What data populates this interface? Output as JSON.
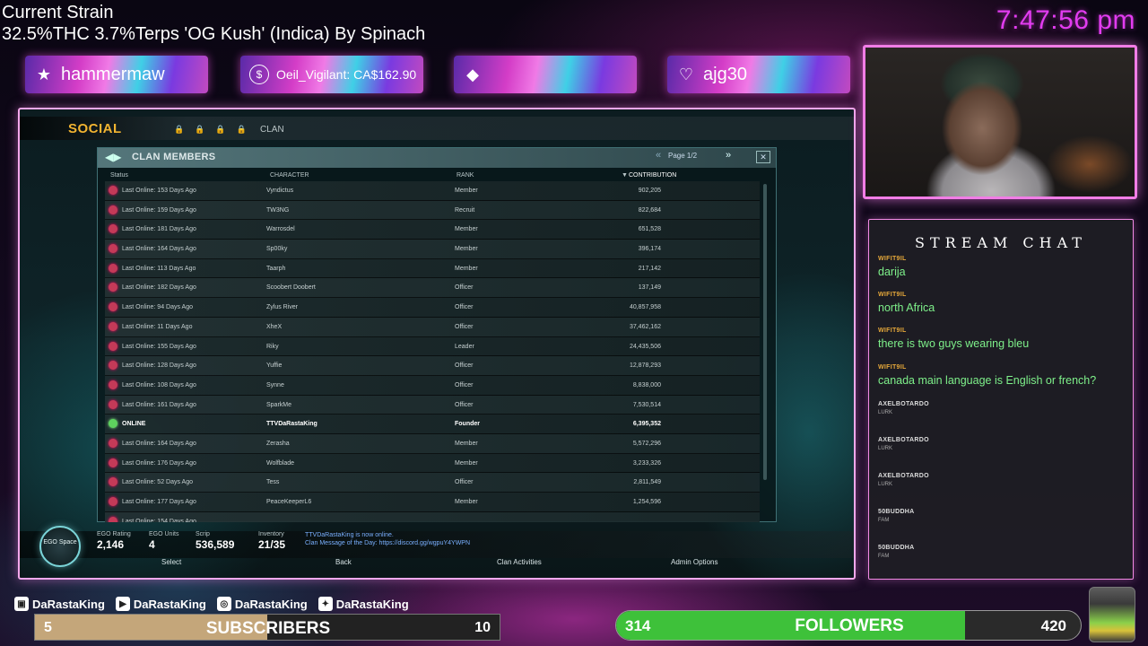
{
  "overlay": {
    "strain_title": "Current Strain",
    "strain_detail": "32.5%THC 3.7%Terps 'OG Kush' (Indica) By Spinach",
    "clock": "7:47:56 pm",
    "banners": [
      {
        "icon": "star-icon",
        "glyph": "★",
        "label": "hammermaw"
      },
      {
        "icon": "dollar-icon",
        "glyph": "$",
        "label": "Oeil_Vigilant: CA$162.90"
      },
      {
        "icon": "diamond-icon",
        "glyph": "◆",
        "label": ""
      },
      {
        "icon": "heart-icon",
        "glyph": "♡",
        "label": "ajg30"
      }
    ]
  },
  "game": {
    "tab_social": "SOCIAL",
    "tab_clan": "CLAN",
    "panel_title": "CLAN MEMBERS",
    "pager": "Page 1/2",
    "columns": {
      "status": "Status",
      "character": "CHARACTER",
      "rank": "RANK",
      "contribution": "CONTRIBUTION"
    },
    "rows": [
      {
        "status": "Last Online: 153 Days Ago",
        "character": "Vyndictus",
        "rank": "Member",
        "contribution": "902,205",
        "online": false
      },
      {
        "status": "Last Online: 159 Days Ago",
        "character": "TW3NG",
        "rank": "Recruit",
        "contribution": "822,684",
        "online": false
      },
      {
        "status": "Last Online: 181 Days Ago",
        "character": "Warrosdel",
        "rank": "Member",
        "contribution": "651,528",
        "online": false
      },
      {
        "status": "Last Online: 164 Days Ago",
        "character": "Sp00ky",
        "rank": "Member",
        "contribution": "396,174",
        "online": false
      },
      {
        "status": "Last Online: 113 Days Ago",
        "character": "Taarph",
        "rank": "Member",
        "contribution": "217,142",
        "online": false
      },
      {
        "status": "Last Online: 182 Days Ago",
        "character": "Scoobert Doobert",
        "rank": "Officer",
        "contribution": "137,149",
        "online": false
      },
      {
        "status": "Last Online: 94 Days Ago",
        "character": "Zylus River",
        "rank": "Officer",
        "contribution": "40,857,958",
        "online": false
      },
      {
        "status": "Last Online: 11 Days Ago",
        "character": "XheX",
        "rank": "Officer",
        "contribution": "37,462,162",
        "online": false
      },
      {
        "status": "Last Online: 155 Days Ago",
        "character": "Riky",
        "rank": "Leader",
        "contribution": "24,435,506",
        "online": false
      },
      {
        "status": "Last Online: 128 Days Ago",
        "character": "Yuffie",
        "rank": "Officer",
        "contribution": "12,878,293",
        "online": false
      },
      {
        "status": "Last Online: 108 Days Ago",
        "character": "Synne",
        "rank": "Officer",
        "contribution": "8,838,000",
        "online": false
      },
      {
        "status": "Last Online: 161 Days Ago",
        "character": "SparkMe",
        "rank": "Officer",
        "contribution": "7,530,514",
        "online": false
      },
      {
        "status": "ONLINE",
        "character": "TTVDaRastaKing",
        "rank": "Founder",
        "contribution": "6,395,352",
        "online": true
      },
      {
        "status": "Last Online: 164 Days Ago",
        "character": "Zerasha",
        "rank": "Member",
        "contribution": "5,572,296",
        "online": false
      },
      {
        "status": "Last Online: 176 Days Ago",
        "character": "Wolfblade",
        "rank": "Member",
        "contribution": "3,233,326",
        "online": false
      },
      {
        "status": "Last Online: 52 Days Ago",
        "character": "Tess",
        "rank": "Officer",
        "contribution": "2,811,549",
        "online": false
      },
      {
        "status": "Last Online: 177 Days Ago",
        "character": "PeaceKeeperL6",
        "rank": "Member",
        "contribution": "1,254,596",
        "online": false
      },
      {
        "status": "Last Online: 154 Days Ago",
        "character": "",
        "rank": "",
        "contribution": "",
        "online": false
      }
    ],
    "footer": {
      "ego_label": "EGO Space",
      "ego_rating_label": "EGO Rating",
      "ego_rating": "2,146",
      "ego_units_label": "EGO Units",
      "ego_units": "4",
      "scrip_label": "Scrip",
      "scrip": "536,589",
      "inventory_label": "Inventory",
      "inventory": "21/35",
      "msg1": "TTVDaRastaKing is now online.",
      "msg2": "Clan Message of the Day: https://discord.gg/wgpuY4YWPN",
      "btn_select": "Select",
      "btn_back": "Back",
      "btn_clan_activities": "Clan Activities",
      "btn_admin": "Admin Options"
    }
  },
  "chat": {
    "title": "STREAM CHAT",
    "messages": [
      {
        "user": "WIFIT9IL",
        "text": "darija",
        "text_color": "#7ef08a"
      },
      {
        "user": "WIFIT9IL",
        "text": "north Africa",
        "text_color": "#7ef08a"
      },
      {
        "user": "WIFIT9IL",
        "text": "there is two guys wearing bleu",
        "text_color": "#7ef08a"
      },
      {
        "user": "WIFIT9IL",
        "text": "canada main language is English or french?",
        "text_color": "#7ef08a"
      },
      {
        "user": "AXELBOTARDO",
        "text": "LURK",
        "text_color": "#aaaaaa"
      },
      {
        "user": "AXELBOTARDO",
        "text": "LURK",
        "text_color": "#aaaaaa"
      },
      {
        "user": "AXELBOTARDO",
        "text": "LURK",
        "text_color": "#aaaaaa"
      },
      {
        "user": "50BUDDHA",
        "text": "FAM",
        "text_color": "#aaaaaa"
      },
      {
        "user": "50BUDDHA",
        "text": "FAM",
        "text_color": "#aaaaaa"
      }
    ]
  },
  "bottom": {
    "socials": [
      {
        "icon": "twitch-icon",
        "glyph": "▣",
        "label": "DaRastaKing"
      },
      {
        "icon": "youtube-icon",
        "glyph": "▶",
        "label": "DaRastaKing"
      },
      {
        "icon": "instagram-icon",
        "glyph": "◎",
        "label": "DaRastaKing"
      },
      {
        "icon": "twitter-icon",
        "glyph": "✦",
        "label": "DaRastaKing"
      }
    ],
    "subs_current": "5",
    "subs_label": "SUBSCRIBERS",
    "subs_goal": "10",
    "subs_progress": 0.5,
    "followers_current": "314",
    "followers_label": "FOLLOWERS",
    "followers_goal": "420",
    "followers_progress": 0.75
  }
}
